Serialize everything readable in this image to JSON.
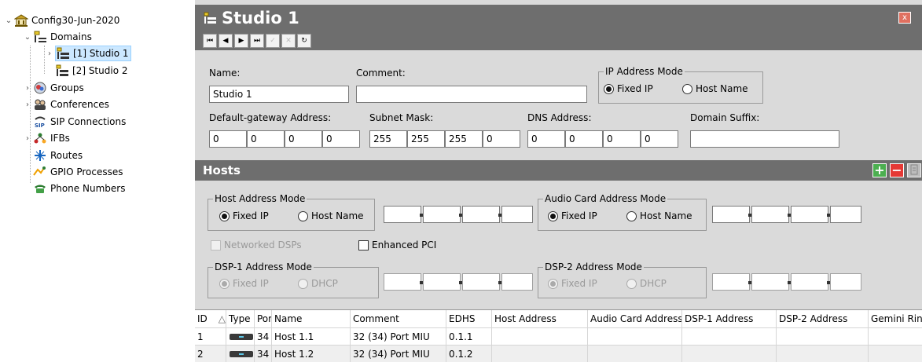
{
  "tree": {
    "root": "Config30-Jun-2020",
    "domains": "Domains",
    "studio1": "[1] Studio 1",
    "studio2": "[2] Studio 2",
    "groups": "Groups",
    "conferences": "Conferences",
    "sip": "SIP Connections",
    "ifbs": "IFBs",
    "routes": "Routes",
    "gpio": "GPIO Processes",
    "phone": "Phone Numbers"
  },
  "window": {
    "title": "Studio 1",
    "close_glyph": "x"
  },
  "toolbar": {
    "first": "⏮",
    "prev": "◀",
    "next": "▶",
    "last": "⏭",
    "apply": "✓",
    "cancel": "✕",
    "refresh": "↻"
  },
  "form": {
    "name_label": "Name:",
    "name_value": "Studio 1",
    "comment_label": "Comment:",
    "comment_value": "",
    "ip_mode_title": "IP Address Mode",
    "fixed_ip": "Fixed IP",
    "host_name": "Host Name",
    "gateway_label": "Default-gateway Address:",
    "gateway": [
      "0",
      "0",
      "0",
      "0"
    ],
    "subnet_label": "Subnet Mask:",
    "subnet": [
      "255",
      "255",
      "255",
      "0"
    ],
    "dns_label": "DNS Address:",
    "dns": [
      "0",
      "0",
      "0",
      "0"
    ],
    "suffix_label": "Domain Suffix:",
    "suffix_value": ""
  },
  "hosts": {
    "title": "Hosts",
    "host_mode_title": "Host Address Mode",
    "audio_mode_title": "Audio Card Address Mode",
    "fixed_ip": "Fixed IP",
    "host_name": "Host Name",
    "networked_dsps": "Networked DSPs",
    "enhanced_pci": "Enhanced PCI",
    "dsp1_title": "DSP-1 Address Mode",
    "dsp2_title": "DSP-2 Address Mode",
    "dhcp": "DHCP"
  },
  "table": {
    "columns": [
      "ID",
      "Type",
      "Port",
      "Name",
      "Comment",
      "EDHS",
      "Host Address",
      "Audio Card Address",
      "DSP-1 Address",
      "DSP-2 Address",
      "Gemini Ring"
    ],
    "sort_glyph": "△",
    "rows": [
      {
        "id": "1",
        "port": "34",
        "name": "Host 1.1",
        "comment": "32 (34) Port MIU",
        "edhs": "0.1.1"
      },
      {
        "id": "2",
        "port": "34",
        "name": "Host 1.2",
        "comment": "32 (34) Port MIU",
        "edhs": "0.1.2"
      }
    ]
  },
  "colors": {
    "panel": "#dadada",
    "header": "#6e6e6e",
    "selection": "#cce8ff",
    "add": "#4caf50",
    "remove": "#e53935"
  }
}
